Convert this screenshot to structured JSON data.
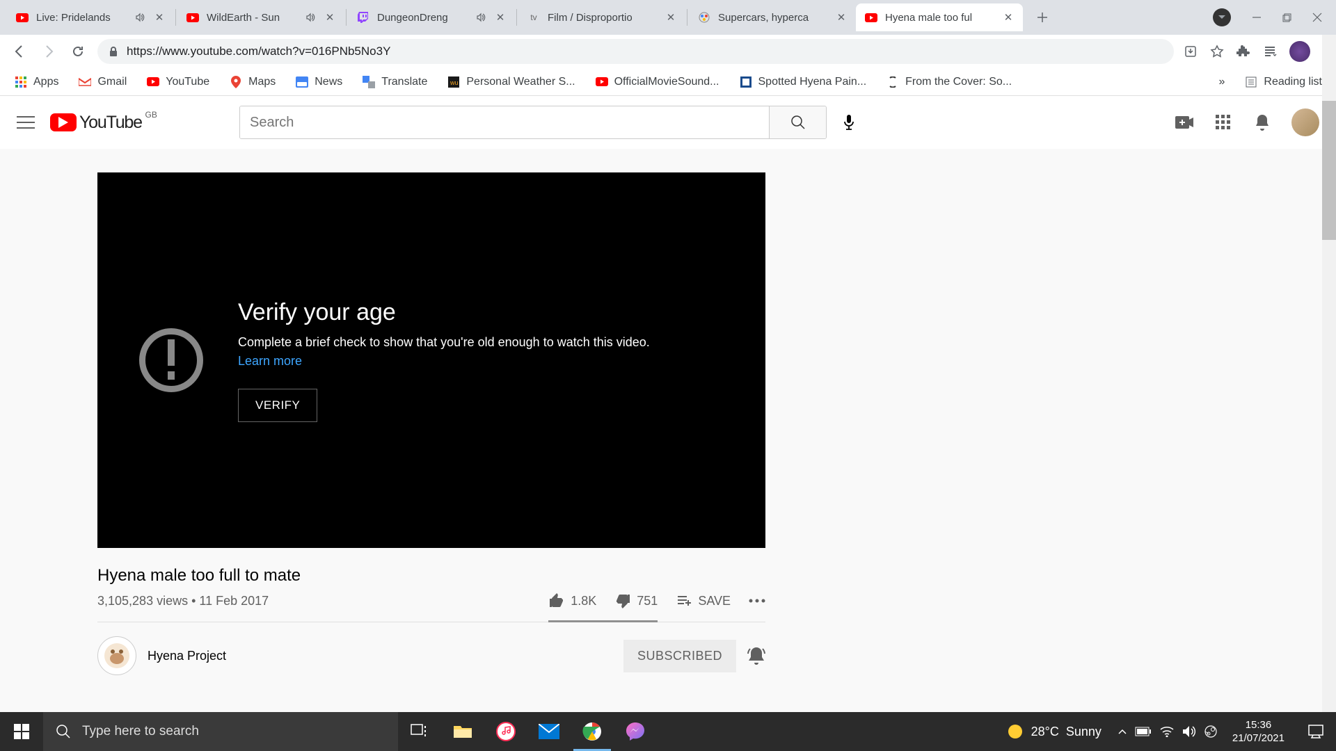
{
  "browser": {
    "tabs": [
      {
        "title": "Live: Pridelands",
        "audio": true,
        "type": "youtube"
      },
      {
        "title": "WildEarth - Sun",
        "audio": true,
        "type": "youtube"
      },
      {
        "title": "DungeonDreng",
        "audio": true,
        "type": "twitch"
      },
      {
        "title": "Film / Disproportio",
        "audio": false,
        "type": "tv"
      },
      {
        "title": "Supercars, hyperca",
        "audio": false,
        "type": "generic"
      },
      {
        "title": "Hyena male too ful",
        "audio": false,
        "type": "youtube",
        "active": true
      }
    ],
    "url": "https://www.youtube.com/watch?v=016PNb5No3Y",
    "bookmarks": [
      "Apps",
      "Gmail",
      "YouTube",
      "Maps",
      "News",
      "Translate",
      "Personal Weather S...",
      "OfficialMovieSound...",
      "Spotted Hyena Pain...",
      "From the Cover: So..."
    ],
    "overflow": "»",
    "reading_list": "Reading list"
  },
  "youtube": {
    "gb": "GB",
    "brand": "YouTube",
    "search_placeholder": "Search",
    "age_gate": {
      "title": "Verify your age",
      "body": "Complete a brief check to show that you're old enough to watch this video. ",
      "learn_more": "Learn more",
      "button": "VERIFY"
    },
    "video": {
      "title": "Hyena male too full to mate",
      "views": "3,105,283 views",
      "date": "11 Feb 2017",
      "likes": "1.8K",
      "dislikes": "751",
      "save": "SAVE"
    },
    "channel": {
      "name": "Hyena Project",
      "subscribe": "SUBSCRIBED"
    }
  },
  "taskbar": {
    "search_placeholder": "Type here to search",
    "weather_temp": "28°C",
    "weather_cond": "Sunny",
    "time": "15:36",
    "date": "21/07/2021"
  }
}
